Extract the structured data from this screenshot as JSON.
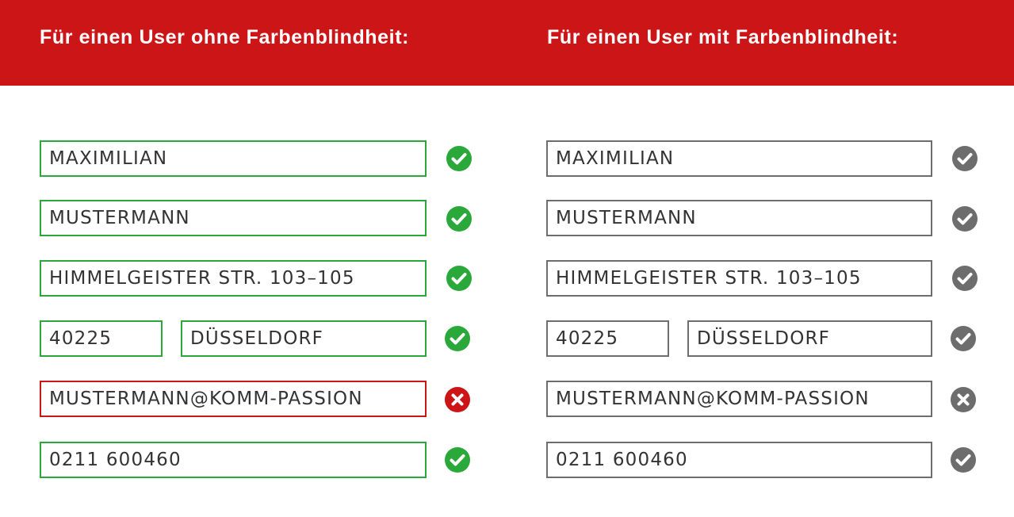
{
  "header": {
    "left_title": "Für einen User ohne Farbenblindheit:",
    "right_title": "Für einen User mit Farbenblindheit:"
  },
  "form": {
    "first_name": "MAXIMILIAN",
    "last_name": "MUSTERMANN",
    "street": "HIMMELGEISTER STR. 103–105",
    "zip": "40225",
    "city": "DÜSSELDORF",
    "email": "MUSTERMANN@KOMM-PASSION",
    "phone": "0211 600460"
  },
  "validation": {
    "first_name": "valid",
    "last_name": "valid",
    "street": "valid",
    "city": "valid",
    "email": "invalid",
    "phone": "valid"
  },
  "colors": {
    "banner": "#cc1517",
    "valid": "#2aa83a",
    "invalid": "#cc1517",
    "colorblind_gray": "#6d6d6d"
  },
  "icons": {
    "valid": "check-circle-icon",
    "invalid": "x-circle-icon"
  }
}
